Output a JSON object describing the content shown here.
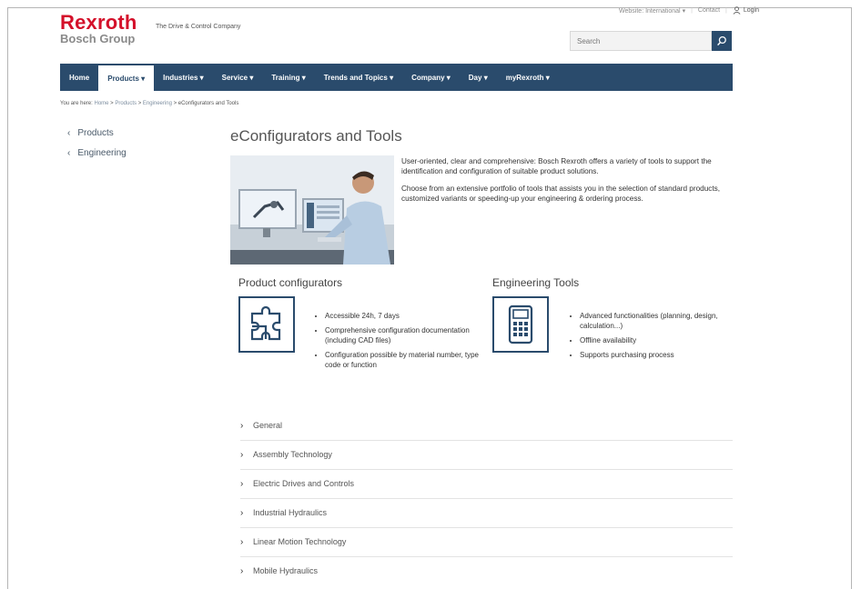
{
  "header": {
    "logo_main": "Rexroth",
    "logo_sub": "Bosch Group",
    "tagline": "The Drive & Control Company",
    "website": "Website: International",
    "contact": "Contact",
    "login": "Login",
    "search_placeholder": "Search"
  },
  "nav": [
    {
      "label": "Home"
    },
    {
      "label": "Products",
      "active": true
    },
    {
      "label": "Industries"
    },
    {
      "label": "Service"
    },
    {
      "label": "Training"
    },
    {
      "label": "Trends and Topics"
    },
    {
      "label": "Company"
    },
    {
      "label": "Day"
    },
    {
      "label": "myRexroth"
    }
  ],
  "breadcrumb": {
    "prefix": "You are here:",
    "home": "Home",
    "products": "Products",
    "engineering": "Engineering",
    "current": "eConfigurators and Tools"
  },
  "sidebar": {
    "items": [
      {
        "label": "Products"
      },
      {
        "label": "Engineering"
      }
    ]
  },
  "page": {
    "title": "eConfigurators and Tools",
    "intro_1": "User-oriented, clear and comprehensive: Bosch Rexroth offers a variety of tools to support the identification and configuration of suitable product solutions.",
    "intro_2": "Choose from an extensive portfolio of tools that assists you in the selection of standard products, customized variants or speeding-up your engineering & ordering process."
  },
  "product_configurators": {
    "title": "Product configurators",
    "icon": "puzzle-icon",
    "bullets": [
      "Accessible 24h, 7 days",
      "Comprehensive configuration documentation (including CAD files)",
      "Configuration possible by material number, type code or function"
    ]
  },
  "engineering_tools": {
    "title": "Engineering Tools",
    "icon": "calculator-icon",
    "bullets": [
      "Advanced functionalities (planning, design, calculation...)",
      "Offline availability",
      "Supports purchasing process"
    ]
  },
  "accordion": [
    {
      "label": "General"
    },
    {
      "label": "Assembly Technology"
    },
    {
      "label": "Electric Drives and Controls"
    },
    {
      "label": "Industrial Hydraulics"
    },
    {
      "label": "Linear Motion Technology"
    },
    {
      "label": "Mobile Hydraulics"
    }
  ],
  "colors": {
    "brand_red": "#d4102a",
    "nav_blue": "#2a4b6c"
  }
}
